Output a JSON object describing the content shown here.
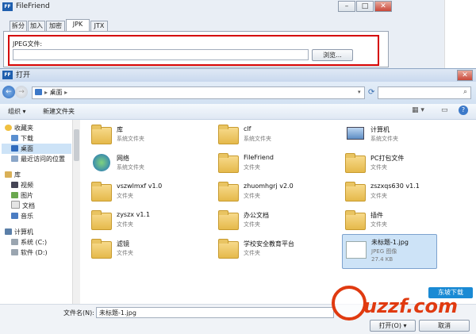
{
  "bg_window": {
    "title": "FileFriend",
    "tabs": [
      "拆分",
      "加入",
      "加密",
      "JPK",
      "JTX"
    ],
    "active_tab": 3,
    "jpeg_label": "JPEG文件:",
    "browse_label": "浏览..."
  },
  "dialog": {
    "title": "打开",
    "breadcrumb": "桌面",
    "toolbar": {
      "organize": "组织",
      "new_folder": "新建文件夹"
    },
    "nav": {
      "favorites_header": "收藏夹",
      "favorites": [
        "下载",
        "桌面",
        "最近访问的位置"
      ],
      "libraries_header": "库",
      "libraries": [
        "视频",
        "图片",
        "文档",
        "音乐"
      ],
      "computer_header": "计算机",
      "drives": [
        "系统 (C:)",
        "软件 (D:)"
      ]
    },
    "files": [
      {
        "name": "库",
        "desc": "系统文件夹",
        "icon": "library-folder-icon"
      },
      {
        "name": "clf",
        "desc": "系统文件夹",
        "icon": "user-folder-icon"
      },
      {
        "name": "计算机",
        "desc": "系统文件夹",
        "icon": "computer-icon"
      },
      {
        "name": "网络",
        "desc": "系统文件夹",
        "icon": "network-icon"
      },
      {
        "name": "FileFriend",
        "desc": "文件夹",
        "icon": "folder-icon"
      },
      {
        "name": "PC打包文件",
        "desc": "文件夹",
        "icon": "folder-icon"
      },
      {
        "name": "vszwlmxf v1.0",
        "desc": "文件夹",
        "icon": "folder-icon"
      },
      {
        "name": "zhuomhgrj v2.0",
        "desc": "文件夹",
        "icon": "folder-icon"
      },
      {
        "name": "zszxqs630 v1.1",
        "desc": "文件夹",
        "icon": "folder-icon"
      },
      {
        "name": "zyszx v1.1",
        "desc": "文件夹",
        "icon": "folder-icon"
      },
      {
        "name": "办公文档",
        "desc": "文件夹",
        "icon": "folder-icon"
      },
      {
        "name": "插件",
        "desc": "文件夹",
        "icon": "folder-icon"
      },
      {
        "name": "滤镜",
        "desc": "文件夹",
        "icon": "folder-icon"
      },
      {
        "name": "学校安全教育平台",
        "desc": "文件夹",
        "icon": "folder-icon"
      },
      {
        "name": "未标题-1.jpg",
        "desc": "JPEG 图像",
        "size": "27.4 KB",
        "icon": "jpeg-image-icon",
        "selected": true
      }
    ],
    "filename_label": "文件名(N):",
    "filename_value": "未标题-1.jpg",
    "open_label": "打开(O)",
    "cancel_label": "取消"
  },
  "watermark": {
    "text": "uzzf.com",
    "badge": "东坡下载"
  },
  "colors": {
    "highlight_red": "#d40000",
    "selection": "#cde3f7",
    "accent": "#1f5fae",
    "watermark": "#e03a10"
  }
}
